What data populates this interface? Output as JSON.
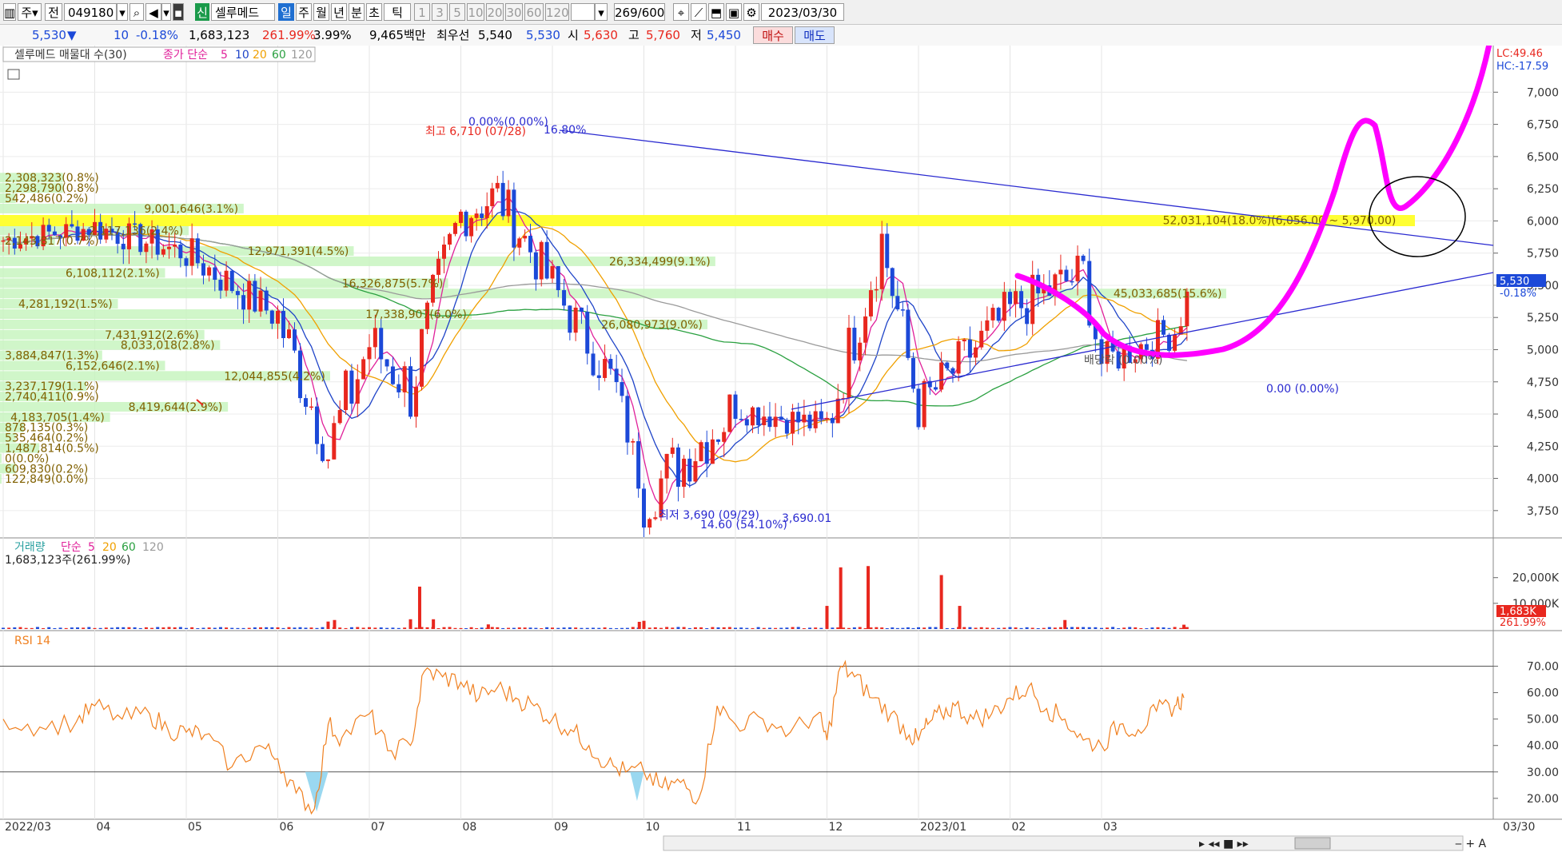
{
  "toolbar": {
    "period_main": "주",
    "prev": "전",
    "code": "049180",
    "new_label": "신",
    "stock_name": "셀루메드",
    "periods": [
      "일",
      "주",
      "월",
      "년",
      "분",
      "초",
      "틱"
    ],
    "minutes": [
      "1",
      "3",
      "5",
      "10",
      "20",
      "30",
      "60",
      "120"
    ],
    "count": "269",
    "count_total": "/600",
    "date": "2023/03/30"
  },
  "quote": {
    "price": "5,530",
    "arrow": "▼",
    "change": "10",
    "change_pct": "-0.18%",
    "volume": "1,683,123",
    "vol_ratio": "261.99%",
    "turnover": "3.99%",
    "amount": "9,465백만",
    "best_ask_label": "최우선",
    "best_ask": "5,540",
    "best_bid": "5,530",
    "open_label": "시",
    "open": "5,630",
    "high_label": "고",
    "high": "5,760",
    "low_label": "저",
    "low": "5,450",
    "buy_button": "매수",
    "sell_button": "매도"
  },
  "colors": {
    "up": "#e8271e",
    "down": "#1c49d8",
    "ma5": "#e0209a",
    "ma10": "#1f44c8",
    "ma20": "#f0a000",
    "ma60": "#2aa040",
    "ma120": "#9a9a9a",
    "rsi": "#f08020",
    "highlight": "#ffff33",
    "profile": "#c8f5c0",
    "trend": "#2a2ad0",
    "drawing": "#ff00ff"
  },
  "chart_data": [
    {
      "type": "candlestick",
      "title": "셀루메드 매물대 수(30)",
      "legend": {
        "label": "종가 단순",
        "periods": [
          "5",
          "10",
          "20",
          "60",
          "120"
        ]
      },
      "x_ticks": [
        "2022/03",
        "04",
        "05",
        "06",
        "07",
        "08",
        "09",
        "10",
        "11",
        "12",
        "2023/01",
        "02",
        "03",
        "03/30"
      ],
      "y_ticks": [
        "7,000",
        "6,750",
        "6,500",
        "6,250",
        "6,000",
        "5,750",
        "5,500",
        "5,250",
        "5,000",
        "4,750",
        "4,500",
        "4,250",
        "4,000",
        "3,750"
      ],
      "ylim": [
        3600,
        7300
      ],
      "lc_label": "LC:49.46",
      "hc_label": "HC:-17.59",
      "last_price": "5,530",
      "last_change": "-0.18%",
      "high_annotation": "최고 6,710 (07/28)",
      "high_pct": "0.00%(0.00%)",
      "high_pct2": "16.80%",
      "low_annotation": "최저 3,690 (09/29)",
      "low_pct": "14.60 (54.10%)",
      "low_value": "3,690.01",
      "trend_label": "0.00 (0.00%)",
      "box_label": "배당락 (0.00%)",
      "segments": [
        {
          "month": 0,
          "start": 5850,
          "end": 5950,
          "amp": 100
        },
        {
          "month": 1,
          "start": 5950,
          "end": 5750,
          "amp": 120
        },
        {
          "month": 2,
          "start": 5750,
          "end": 5250,
          "amp": 150
        },
        {
          "month": 3,
          "start": 5250,
          "end": 4250,
          "amp": 250
        },
        {
          "month": 3.55,
          "start": 4200,
          "end": 5050,
          "amp": 300
        },
        {
          "month": 4,
          "start": 5050,
          "end": 4700,
          "amp": 250
        },
        {
          "month": 4.45,
          "start": 4700,
          "end": 6050,
          "amp": 300
        },
        {
          "month": 5,
          "start": 6050,
          "end": 6200,
          "amp": 200
        },
        {
          "month": 5.4,
          "start": 6200,
          "end": 5500,
          "amp": 200
        },
        {
          "month": 6,
          "start": 5500,
          "end": 4700,
          "amp": 200
        },
        {
          "month": 6.7,
          "start": 4700,
          "end": 3850,
          "amp": 150
        },
        {
          "month": 7,
          "start": 3850,
          "end": 4550,
          "amp": 250
        },
        {
          "month": 8,
          "start": 4550,
          "end": 4400,
          "amp": 120
        },
        {
          "month": 9,
          "start": 4400,
          "end": 5850,
          "amp": 250
        },
        {
          "month": 9.6,
          "start": 5850,
          "end": 4550,
          "amp": 250
        },
        {
          "month": 10,
          "start": 4550,
          "end": 5300,
          "amp": 200
        },
        {
          "month": 11,
          "start": 5300,
          "end": 5600,
          "amp": 200
        },
        {
          "month": 11.8,
          "start": 5600,
          "end": 4900,
          "amp": 200
        },
        {
          "month": 12,
          "start": 4900,
          "end": 5150,
          "amp": 150
        },
        {
          "month": 12.8,
          "start": 5150,
          "end": 5530,
          "amp": 150
        }
      ],
      "volume_profile": [
        {
          "label": "2,308,323(0.8%)",
          "price": 6330,
          "pct": 0.8
        },
        {
          "label": "2,298,790(0.8%)",
          "price": 6250,
          "pct": 0.8
        },
        {
          "label": "542,486(0.2%)",
          "price": 6170,
          "pct": 0.2
        },
        {
          "label": "9,001,646(3.1%)",
          "price": 6090,
          "pct": 3.1
        },
        {
          "label": "52,031,104(18.0%)(6,056.00 ~ 5,970.00)",
          "price": 6000,
          "pct": 18.0
        },
        {
          "label": "2,117,136(2.4%)",
          "price": 5920,
          "pct": 2.4
        },
        {
          "label": "2,143,817(0.7%)",
          "price": 5840,
          "pct": 0.7
        },
        {
          "label": "12,971,391(4.5%)",
          "price": 5760,
          "pct": 4.5
        },
        {
          "label": "26,334,499(9.1%)",
          "price": 5680,
          "pct": 9.1
        },
        {
          "label": "6,108,112(2.1%)",
          "price": 5590,
          "pct": 2.1
        },
        {
          "label": "16,326,875(5.7%)",
          "price": 5510,
          "pct": 5.7
        },
        {
          "label": "45,033,685(15.6%)",
          "price": 5430,
          "pct": 15.6
        },
        {
          "label": "4,281,192(1.5%)",
          "price": 5350,
          "pct": 1.5
        },
        {
          "label": "17,338,907(6.0%)",
          "price": 5270,
          "pct": 6.0
        },
        {
          "label": "26,080,973(9.0%)",
          "price": 5190,
          "pct": 9.0
        },
        {
          "label": "7,431,912(2.6%)",
          "price": 5110,
          "pct": 2.6
        },
        {
          "label": "8,033,018(2.8%)",
          "price": 5030,
          "pct": 2.8
        },
        {
          "label": "3,884,847(1.3%)",
          "price": 4950,
          "pct": 1.3
        },
        {
          "label": "6,152,646(2.1%)",
          "price": 4870,
          "pct": 2.1
        },
        {
          "label": "12,044,855(4.2%)",
          "price": 4790,
          "pct": 4.2
        },
        {
          "label": "3,237,179(1.1%)",
          "price": 4710,
          "pct": 1.1
        },
        {
          "label": "2,740,411(0.9%)",
          "price": 4630,
          "pct": 0.9
        },
        {
          "label": "8,419,644(2.9%)",
          "price": 4550,
          "pct": 2.9
        },
        {
          "label": "4,183,705(1.4%)",
          "price": 4470,
          "pct": 1.4
        },
        {
          "label": "878,135(0.3%)",
          "price": 4390,
          "pct": 0.3
        },
        {
          "label": "535,464(0.2%)",
          "price": 4310,
          "pct": 0.2
        },
        {
          "label": "1,487,814(0.5%)",
          "price": 4230,
          "pct": 0.5
        },
        {
          "label": "0(0.0%)",
          "price": 4150,
          "pct": 0.0
        },
        {
          "label": "609,830(0.2%)",
          "price": 4070,
          "pct": 0.2
        },
        {
          "label": "122,849(0.0%)",
          "price": 3990,
          "pct": 0.0
        }
      ]
    },
    {
      "type": "bar",
      "title": "거래량",
      "legend": {
        "label": "단순",
        "periods": [
          "5",
          "20",
          "60",
          "120"
        ]
      },
      "info": "1,683,123주(261.99%)",
      "y_ticks": [
        "20,000K",
        "10,000K"
      ],
      "ylim": [
        0,
        28000
      ],
      "last_value": "1,683K",
      "last_pct": "261.99%",
      "spikes": [
        {
          "month": 3.55,
          "value": 2900
        },
        {
          "month": 3.62,
          "value": 3500
        },
        {
          "month": 4.45,
          "value": 3800
        },
        {
          "month": 4.55,
          "value": 16500
        },
        {
          "month": 4.7,
          "value": 3800
        },
        {
          "month": 5.3,
          "value": 1800
        },
        {
          "month": 6.95,
          "value": 2800
        },
        {
          "month": 7.0,
          "value": 3200
        },
        {
          "month": 9.0,
          "value": 9000
        },
        {
          "month": 9.15,
          "value": 24000
        },
        {
          "month": 9.45,
          "value": 24500
        },
        {
          "month": 10.25,
          "value": 21000
        },
        {
          "month": 10.45,
          "value": 9000
        },
        {
          "month": 11.6,
          "value": 3500
        },
        {
          "month": 12.9,
          "value": 1683
        }
      ]
    },
    {
      "type": "line",
      "title": "RSI 14",
      "y_ticks": [
        "70.00",
        "60.00",
        "50.00",
        "40.00",
        "30.00",
        "20.00"
      ],
      "ylim": [
        13,
        75
      ],
      "levels": [
        70,
        30
      ],
      "series": [
        {
          "x": [
            0,
            0.4,
            0.8,
            1.0,
            1.3,
            1.6,
            1.8,
            2.0,
            2.2,
            2.5,
            2.8,
            3.0,
            3.2,
            3.4,
            3.55,
            3.7,
            4.0,
            4.2,
            4.45,
            4.6,
            4.8,
            5.0,
            5.2,
            5.4,
            5.6,
            5.8,
            6.0,
            6.2,
            6.4,
            6.6,
            6.8,
            7.0,
            7.2,
            7.4,
            7.6,
            7.8,
            8.0,
            8.3,
            8.6,
            8.9,
            9.0,
            9.15,
            9.3,
            9.5,
            9.7,
            9.9,
            10.0,
            10.1,
            10.25,
            10.4,
            10.6,
            10.8,
            11.0,
            11.2,
            11.4,
            11.6,
            11.8,
            12.0,
            12.2,
            12.4,
            12.6,
            12.8,
            12.9
          ],
          "values": [
            50,
            47,
            49,
            55,
            50,
            52,
            46,
            45,
            44,
            32,
            40,
            35,
            22,
            16,
            48,
            43,
            52,
            38,
            40,
            68,
            66,
            64,
            58,
            62,
            58,
            55,
            50,
            46,
            40,
            33,
            30,
            30,
            24,
            26,
            20,
            55,
            48,
            50,
            45,
            52,
            42,
            70,
            66,
            58,
            52,
            44,
            42,
            48,
            52,
            55,
            50,
            52,
            58,
            62,
            54,
            50,
            42,
            40,
            48,
            46,
            53,
            55,
            58
          ]
        }
      ]
    }
  ]
}
